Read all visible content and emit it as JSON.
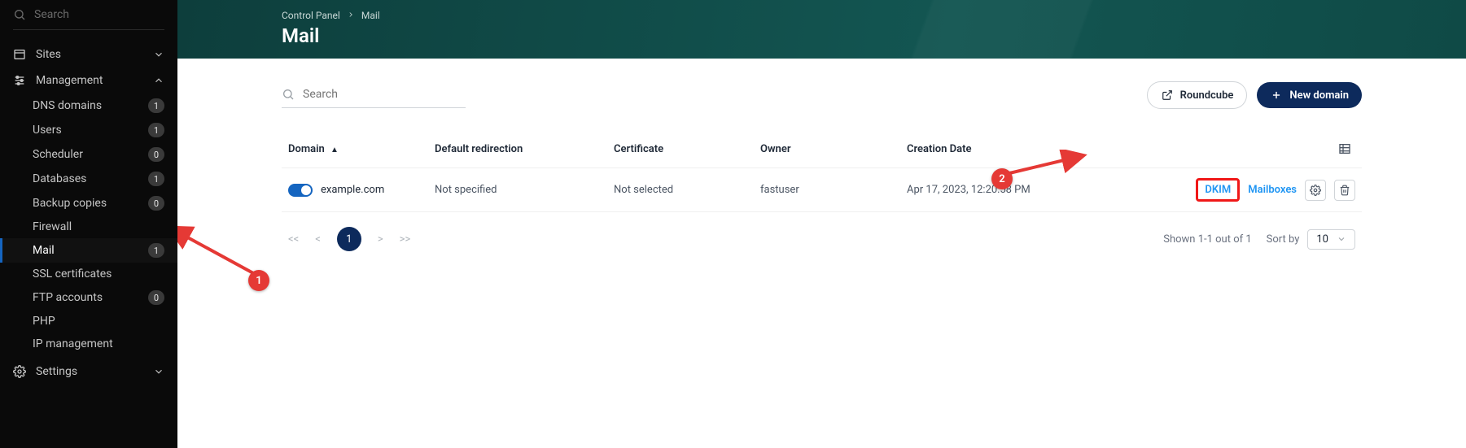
{
  "sidebar": {
    "search_placeholder": "Search",
    "sites_label": "Sites",
    "management_label": "Management",
    "settings_label": "Settings",
    "items": [
      {
        "label": "DNS domains",
        "badge": "1"
      },
      {
        "label": "Users",
        "badge": "1"
      },
      {
        "label": "Scheduler",
        "badge": "0"
      },
      {
        "label": "Databases",
        "badge": "1"
      },
      {
        "label": "Backup copies",
        "badge": "0"
      },
      {
        "label": "Firewall",
        "badge": null
      },
      {
        "label": "Mail",
        "badge": "1"
      },
      {
        "label": "SSL certificates",
        "badge": null
      },
      {
        "label": "FTP accounts",
        "badge": "0"
      },
      {
        "label": "PHP",
        "badge": null
      },
      {
        "label": "IP management",
        "badge": null
      }
    ]
  },
  "breadcrumb": {
    "root": "Control Panel",
    "current": "Mail"
  },
  "page_title": "Mail",
  "toolbar": {
    "search_placeholder": "Search",
    "roundcube_label": "Roundcube",
    "new_domain_label": "New domain"
  },
  "table": {
    "headers": {
      "domain": "Domain",
      "redirection": "Default redirection",
      "certificate": "Certificate",
      "owner": "Owner",
      "creation": "Creation Date"
    },
    "row": {
      "domain": "example.com",
      "redirection": "Not specified",
      "certificate": "Not selected",
      "owner": "fastuser",
      "creation": "Apr 17, 2023, 12:20:58 PM",
      "dkim_label": "DKIM",
      "mailboxes_label": "Mailboxes"
    }
  },
  "footer": {
    "page_current": "1",
    "shown_text": "Shown 1-1 out of 1",
    "sort_by_label": "Sort by",
    "page_size": "10"
  },
  "annotations": {
    "marker1": "1",
    "marker2": "2"
  }
}
